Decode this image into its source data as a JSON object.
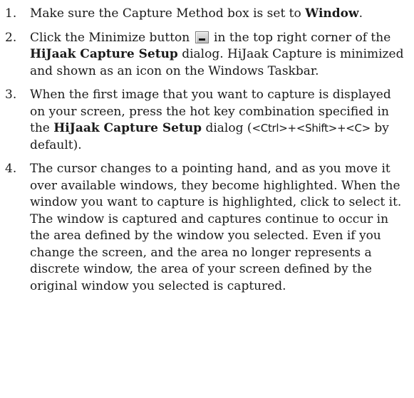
{
  "steps": [
    {
      "number": "1.",
      "text_1": "Make sure the Capture Method box is set to ",
      "bold_1": "Window",
      "text_2": "."
    },
    {
      "number": "2.",
      "text_1": "Click the Minimize button ",
      "icon": "minimize-button-icon",
      "text_2": " in the top right corner of the ",
      "bold_1": "HiJaak Capture Setup",
      "text_3": " dialog. HiJaak Capture is minimized and shown as an icon on the Windows Taskbar."
    },
    {
      "number": "3.",
      "text_1": "When the first image that you want to capture is displayed on your screen, press the hot key combination specified in the ",
      "bold_1": "HiJaak Capture Setup",
      "text_2": " dialog (",
      "key_combo": "<Ctrl>+<Shift>+<C>",
      "text_3": " by default)."
    },
    {
      "number": "4.",
      "text_1": "The cursor changes to a pointing hand, and as you move it over available windows, they become highlighted. When the window you want to capture is highlighted, click to select it. The window is captured and captures continue to occur in the area defined by the window you selected. Even if you change the screen, and the area no longer represents a discrete window, the area of your screen defined by the original window you selected is captured."
    }
  ]
}
